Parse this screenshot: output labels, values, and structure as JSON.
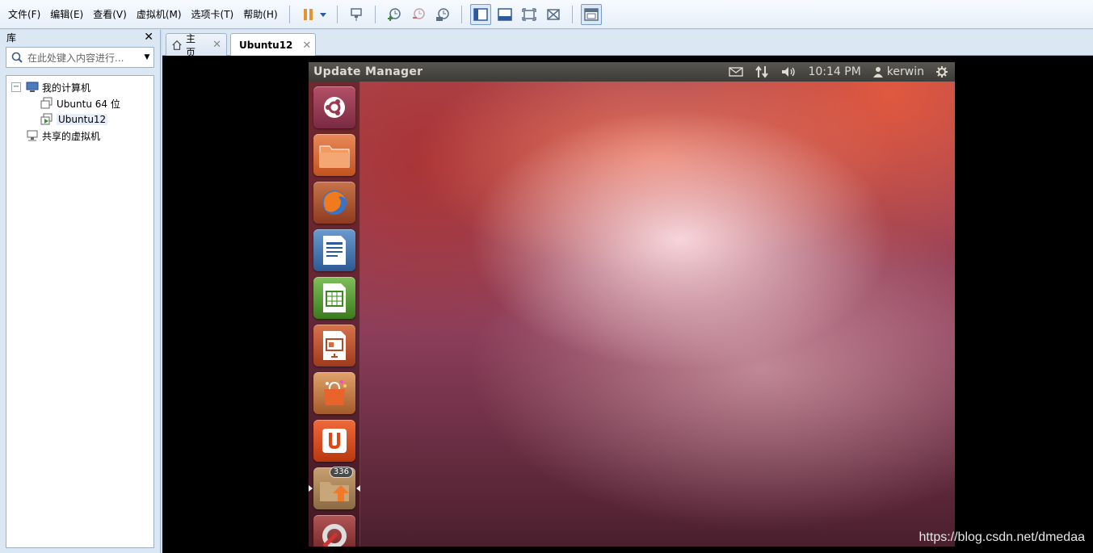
{
  "menubar": {
    "items": [
      "文件(F)",
      "编辑(E)",
      "查看(V)",
      "虚拟机(M)",
      "选项卡(T)",
      "帮助(H)"
    ]
  },
  "toolbar": {
    "icons": [
      "pause-icon",
      "dropdown-arrow-icon",
      "send-ctrl-alt-del-icon",
      "snapshot-take-icon",
      "snapshot-revert-icon",
      "snapshot-manager-icon",
      "view-library-icon",
      "view-thumbnail-icon",
      "fullscreen-icon",
      "unity-icon",
      "console-view-icon"
    ]
  },
  "library": {
    "title": "库",
    "close": "✕",
    "search_placeholder": "在此处键入内容进行...",
    "tree": {
      "root": "我的计算机",
      "vms": [
        "Ubuntu 64 位",
        "Ubuntu12"
      ],
      "shared": "共享的虚拟机"
    }
  },
  "tabs": [
    {
      "label": "主页",
      "active": false
    },
    {
      "label": "Ubuntu12",
      "active": true
    }
  ],
  "guest": {
    "panel_title": "Update Manager",
    "clock": "10:14 PM",
    "user": "kerwin",
    "launcher": [
      {
        "name": "dash-home",
        "color": "#9a3a52"
      },
      {
        "name": "files-home",
        "color": "#c9622e"
      },
      {
        "name": "firefox",
        "color": "#b2552e"
      },
      {
        "name": "libreoffice-writer",
        "color": "#3c6c9e"
      },
      {
        "name": "libreoffice-calc",
        "color": "#4e8e2c"
      },
      {
        "name": "libreoffice-impress",
        "color": "#b04a28"
      },
      {
        "name": "ubuntu-software-center",
        "color": "#b6602e"
      },
      {
        "name": "ubuntu-one",
        "color": "#c84a24"
      },
      {
        "name": "update-manager",
        "color": "#a87e58",
        "badge": "336"
      },
      {
        "name": "system-settings",
        "color": "#8a3838"
      }
    ]
  },
  "watermark": "https://blog.csdn.net/dmedaa",
  "colors": {
    "vmware_chrome": "#dce7f4",
    "ubuntu_panel": "#3c3b37",
    "ubuntu_orange": "#dd4814"
  }
}
